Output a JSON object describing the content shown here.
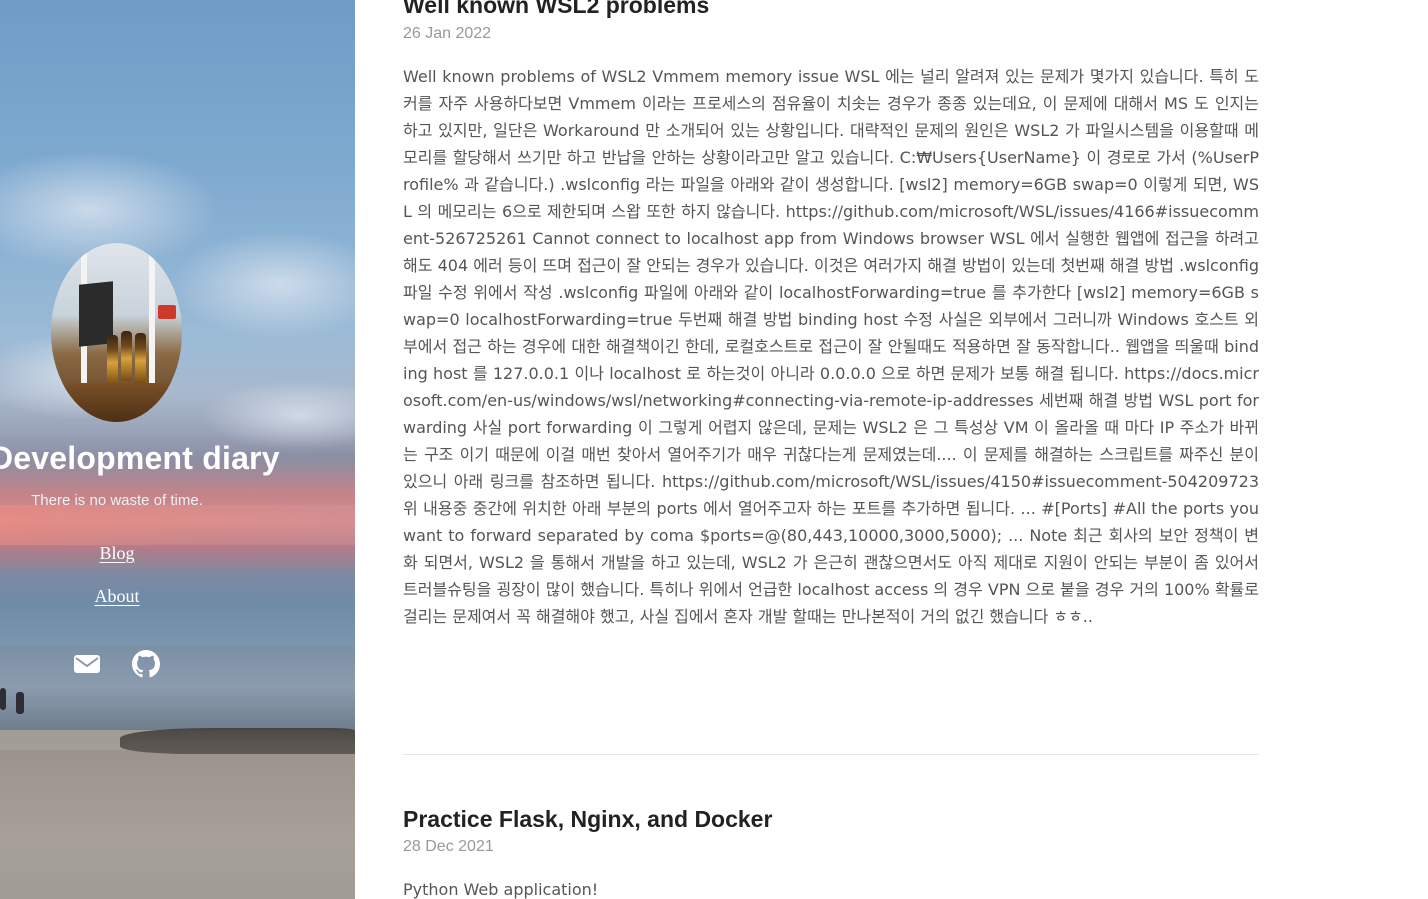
{
  "sidebar": {
    "site_title": "Development diary",
    "tagline": "There is no waste of time.",
    "nav": {
      "blog": "Blog",
      "about": "About"
    },
    "social_icons": [
      "mail-icon",
      "github-icon"
    ]
  },
  "posts": [
    {
      "title": "Well known WSL2 problems",
      "date": "26 Jan 2022",
      "excerpt": "Well known problems of WSL2 Vmmem memory issue WSL 에는 널리 알려져 있는 문제가 몇가지 있습니다. 특히 도커를 자주 사용하다보면 Vmmem 이라는 프로세스의 점유율이 치솟는 경우가 종종 있는데요, 이 문제에 대해서 MS 도 인지는 하고 있지만, 일단은 Workaround 만 소개되어 있는 상황입니다. 대략적인 문제의 원인은 WSL2 가 파일시스템을 이용할때 메모리를 할당해서 쓰기만 하고 반납을 안하는 상황이라고만 알고 있습니다. C:₩Users{UserName} 이 경로로 가서 (%UserProfile% 과 같습니다.) .wslconfig 라는 파일을 아래와 같이 생성합니다. [wsl2] memory=6GB swap=0 이렇게 되면, WSL 의 메모리는 6으로 제한되며 스왑 또한 하지 않습니다. https://github.com/microsoft/WSL/issues/4166#issuecomment-526725261 Cannot connect to localhost app from Windows browser WSL 에서 실행한 웹앱에 접근을 하려고 해도 404 에러 등이 뜨며 접근이 잘 안되는 경우가 있습니다. 이것은 여러가지 해결 방법이 있는데 첫번째 해결 방법 .wslconfig 파일 수정 위에서 작성 .wslconfig 파일에 아래와 같이 localhostForwarding=true 를 추가한다 [wsl2] memory=6GB swap=0 localhostForwarding=true 두번째 해결 방법 binding host 수정 사실은 외부에서 그러니까 Windows 호스트 외부에서 접근 하는 경우에 대한 해결책이긴 한데, 로컬호스트로 접근이 잘 안될때도 적용하면 잘 동작합니다.. 웹앱을 띄울때 binding host 를 127.0.0.1 이나 localhost 로 하는것이 아니라 0.0.0.0 으로 하면 문제가 보통 해결 됩니다. https://docs.microsoft.com/en-us/windows/wsl/networking#connecting-via-remote-ip-addresses 세번째 해결 방법 WSL port forwarding 사실 port forwarding 이 그렇게 어렵지 않은데, 문제는 WSL2 은 그 특성상 VM 이 올라올 때 마다 IP 주소가 바뀌는 구조 이기 때문에 이걸 매번 찾아서 열어주기가 매우 귀찮다는게 문제였는데.... 이 문제를 해결하는 스크립트를 짜주신 분이 있으니 아래 링크를 참조하면 됩니다. https://github.com/microsoft/WSL/issues/4150#issuecomment-504209723 위 내용중 중간에 위치한 아래 부분의 ports 에서 열어주고자 하는 포트를 추가하면 됩니다. ... #[Ports] #All the ports you want to forward separated by coma $ports=@(80,443,10000,3000,5000); ... Note 최근 회사의 보안 정책이 변화 되면서, WSL2 을 통해서 개발을 하고 있는데, WSL2 가 은근히 괜찮으면서도 아직 제대로 지원이 안되는 부분이 좀 있어서 트러블슈팅을 굉장이 많이 했습니다. 특히나 위에서 언급한 localhost access 의 경우 VPN 으로 붙을 경우 거의 100% 확률로 걸리는 문제여서 꼭 해결해야 했고, 사실 집에서 혼자 개발 할때는 만나본적이 거의 없긴 했습니다 ㅎㅎ.."
    },
    {
      "title": "Practice Flask, Nginx, and Docker",
      "date": "28 Dec 2021",
      "excerpt": "Python Web application!"
    }
  ],
  "colors": {
    "title": "#222222",
    "date": "#999999",
    "body_text": "#555555",
    "divider": "#e5e5e5",
    "sidebar_text": "#ffffff"
  }
}
